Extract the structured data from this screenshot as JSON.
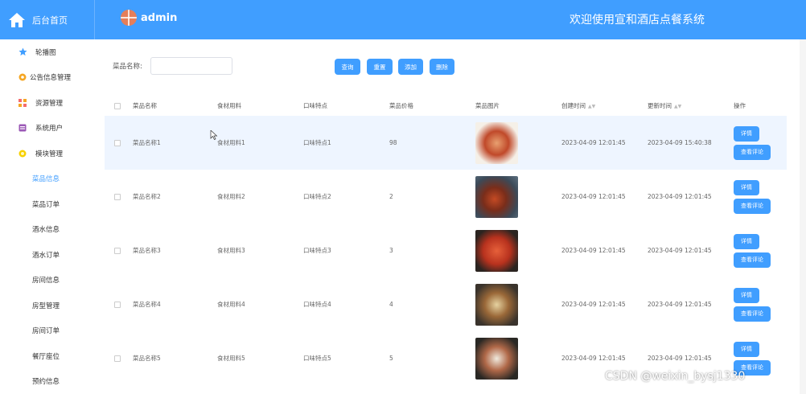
{
  "header": {
    "logo_text": "后台首页",
    "user_name": "admin",
    "welcome": "欢迎使用宣和酒店点餐系统"
  },
  "sidebar": {
    "items": [
      {
        "label": "轮播图",
        "icon": "star-icon",
        "color": "#409eff"
      },
      {
        "label": "公告信息管理",
        "icon": "gear-icon",
        "color": "#f5a623"
      },
      {
        "label": "资源管理",
        "icon": "grid-icon",
        "color": "#f56c6c"
      },
      {
        "label": "系统用户",
        "icon": "user-icon",
        "color": "#9b59b6"
      },
      {
        "label": "模块管理",
        "icon": "module-icon",
        "color": "#f7d000"
      }
    ],
    "sub_items": [
      "菜品信息",
      "菜品订单",
      "酒水信息",
      "酒水订单",
      "房间信息",
      "房型管理",
      "房间订单",
      "餐厅座位",
      "预约信息"
    ],
    "active_sub": "菜品信息"
  },
  "search": {
    "label": "菜品名称:",
    "value": "",
    "placeholder": "",
    "query_btn": "查询",
    "reset_btn": "重置",
    "add_btn": "添加",
    "delete_btn": "删除"
  },
  "table": {
    "headers": [
      "菜品名称",
      "食材用料",
      "口味特点",
      "菜品价格",
      "菜品图片",
      "创建时间",
      "更新时间",
      "操作"
    ],
    "sort_icon": "sort-icon",
    "rows": [
      {
        "name": "菜品名称1",
        "ingredients": "食材用料1",
        "taste": "口味特点1",
        "price": "98",
        "created": "2023-04-09 12:01:45",
        "updated": "2023-04-09 15:40:38"
      },
      {
        "name": "菜品名称2",
        "ingredients": "食材用料2",
        "taste": "口味特点2",
        "price": "2",
        "created": "2023-04-09 12:01:45",
        "updated": "2023-04-09 12:01:45"
      },
      {
        "name": "菜品名称3",
        "ingredients": "食材用料3",
        "taste": "口味特点3",
        "price": "3",
        "created": "2023-04-09 12:01:45",
        "updated": "2023-04-09 12:01:45"
      },
      {
        "name": "菜品名称4",
        "ingredients": "食材用料4",
        "taste": "口味特点4",
        "price": "4",
        "created": "2023-04-09 12:01:45",
        "updated": "2023-04-09 12:01:45"
      },
      {
        "name": "菜品名称5",
        "ingredients": "食材用料5",
        "taste": "口味特点5",
        "price": "5",
        "created": "2023-04-09 12:01:45",
        "updated": "2023-04-09 12:01:45"
      }
    ],
    "detail_btn": "详情",
    "comment_btn": "查看评论"
  },
  "watermark": "CSDN @weixin_bysj1330",
  "colors": {
    "primary": "#409eff",
    "highlight_row": "#eef5ff"
  }
}
